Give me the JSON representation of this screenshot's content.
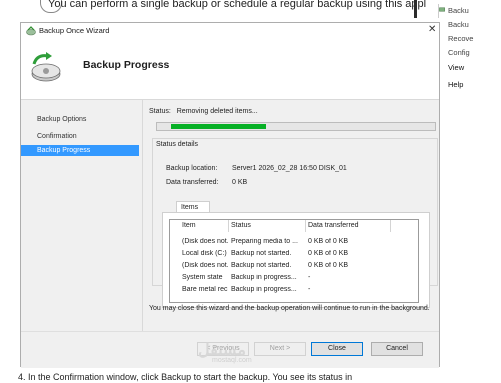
{
  "background": {
    "top_text": "You can perform a single backup or schedule a regular backup using this appl",
    "right_items": [
      "Backu",
      "Backu",
      "Recove",
      "Config",
      "View",
      "Help"
    ],
    "bottom_text": "4.  In the Confirmation window, click Backup to start the backup. You see its status in"
  },
  "dialog": {
    "title": "Backup Once Wizard",
    "header_title": "Backup Progress",
    "nav": [
      "Backup Options",
      "Confirmation",
      "Backup Progress"
    ],
    "selected_nav_index": 2,
    "status_label": "Status:",
    "status_value": "Removing deleted items...",
    "progress_fraction": 0.3,
    "status_details_title": "Status details",
    "backup_location_label": "Backup location:",
    "backup_location_value": "Server1 2026_02_28 16:50 DISK_01",
    "data_transferred_label": "Data transferred:",
    "data_transferred_value": "0 KB",
    "items_tab": "Items",
    "columns": [
      "Item",
      "Status",
      "Data transferred"
    ],
    "rows": [
      {
        "item": "(Disk does not...",
        "status": "Preparing media to ...",
        "data": "0 KB of 0 KB"
      },
      {
        "item": "Local disk (C:)",
        "status": "Backup not started.",
        "data": "0 KB of 0 KB"
      },
      {
        "item": "(Disk does not...",
        "status": "Backup not started.",
        "data": "0 KB of 0 KB"
      },
      {
        "item": "System state",
        "status": "Backup in progress...",
        "data": "-"
      },
      {
        "item": "Bare metal rec...",
        "status": "Backup in progress...",
        "data": "-"
      }
    ],
    "note": "You may close this wizard and the backup operation will continue to run in the background.",
    "buttons": {
      "previous": "< Previous",
      "next": "Next >",
      "close": "Close",
      "cancel": "Cancel"
    },
    "close_glyph": "✕"
  },
  "watermark": {
    "main": "مستقل",
    "sub": "mostaql.com"
  },
  "colors": {
    "progress": "#06b025",
    "selection": "#3399ff",
    "default_button_border": "#0078d7"
  }
}
